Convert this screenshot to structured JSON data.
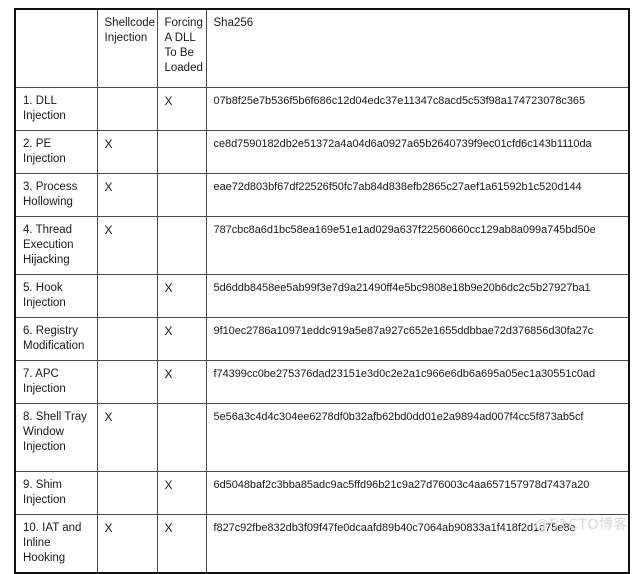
{
  "table": {
    "columns": [
      {
        "key": "technique",
        "label": ""
      },
      {
        "key": "shellcode",
        "label": "Shellcode Injection"
      },
      {
        "key": "forcing",
        "label": "Forcing A DLL To Be Loaded"
      },
      {
        "key": "sha256",
        "label": "Sha256"
      }
    ],
    "mark": "X",
    "rows": [
      {
        "technique": "1. DLL Injection",
        "shellcode": "",
        "forcing": "X",
        "sha256": "07b8f25e7b536f5b6f686c12d04edc37e11347c8acd5c53f98a174723078c365"
      },
      {
        "technique": "2. PE Injection",
        "shellcode": "X",
        "forcing": "",
        "sha256": "ce8d7590182db2e51372a4a04d6a0927a65b2640739f9ec01cfd6c143b1110da"
      },
      {
        "technique": "3. Process Hollowing",
        "shellcode": "X",
        "forcing": "",
        "sha256": "eae72d803bf67df22526f50fc7ab84d838efb2865c27aef1a61592b1c520d144"
      },
      {
        "technique": "4. Thread Execution Hijacking",
        "shellcode": "X",
        "forcing": "",
        "sha256": "787cbc8a6d1bc58ea169e51e1ad029a637f22560660cc129ab8a099a745bd50e"
      },
      {
        "technique": "5. Hook Injection",
        "shellcode": "",
        "forcing": "X",
        "sha256": "5d6ddb8458ee5ab99f3e7d9a21490ff4e5bc9808e18b9e20b6dc2c5b27927ba1"
      },
      {
        "technique": "6. Registry Modification",
        "shellcode": "",
        "forcing": "X",
        "sha256": "9f10ec2786a10971eddc919a5e87a927c652e1655ddbbae72d376856d30fa27c"
      },
      {
        "technique": "7. APC Injection",
        "shellcode": "",
        "forcing": "X",
        "sha256": "f74399cc0be275376dad23151e3d0c2e2a1c966e6db6a695a05ec1a30551c0ad"
      },
      {
        "technique": "8. Shell Tray Window Injection",
        "shellcode": "X",
        "forcing": "",
        "sha256": "5e56a3c4d4c304ee6278df0b32afb62bd0dd01e2a9894ad007f4cc5f873ab5cf"
      },
      {
        "technique": "9. Shim Injection",
        "shellcode": "",
        "forcing": "X",
        "sha256": "6d5048baf2c3bba85adc9ac5ffd96b21c9a27d76003c4aa657157978d7437a20"
      },
      {
        "technique": "10. IAT and Inline Hooking",
        "shellcode": "X",
        "forcing": "X",
        "sha256": "f827c92fbe832db3f09f47fe0dcaafd89b40c7064ab90833a1f418f2d1e75e8e"
      }
    ]
  },
  "watermark": {
    "text": "@51CTO博客"
  },
  "colors": {
    "page_background": "#ffffff",
    "grid_line": "#4a4a4a",
    "outer_frame": "#111111",
    "text": "#1a1a1a",
    "watermark": "#d9d9d9"
  }
}
